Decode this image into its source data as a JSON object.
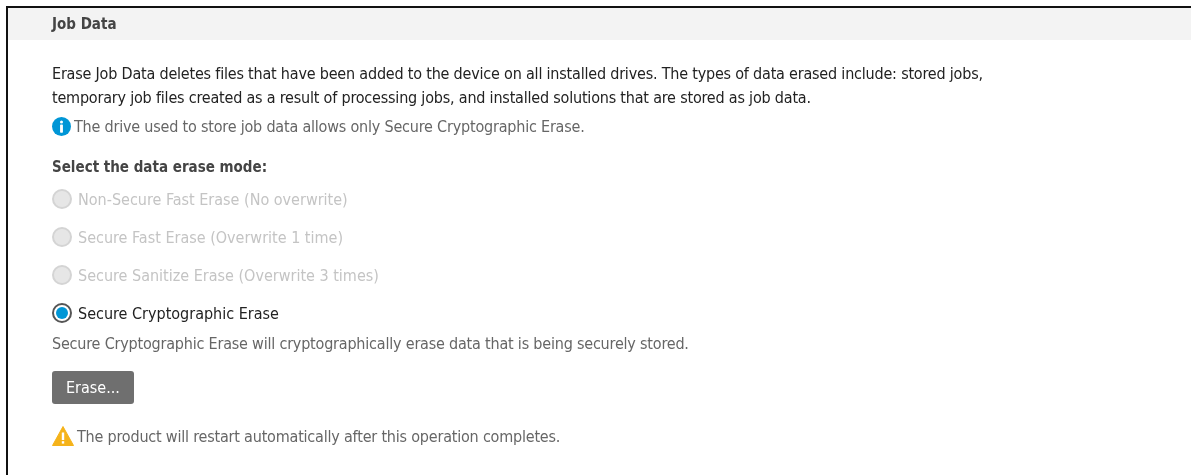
{
  "section": {
    "title": "Job Data"
  },
  "description": "Erase Job Data deletes files that have been added to the device on all installed drives. The types of data erased include: stored jobs, temporary job files created as a result of processing jobs, and installed solutions that are stored as job data.",
  "info_note": "The drive used to store job data allows only Secure Cryptographic Erase.",
  "mode_label": "Select the data erase mode:",
  "modes": [
    {
      "label": "Non-Secure Fast Erase (No overwrite)",
      "selected": false,
      "disabled": true
    },
    {
      "label": "Secure Fast Erase (Overwrite 1 time)",
      "selected": false,
      "disabled": true
    },
    {
      "label": "Secure Sanitize Erase (Overwrite 3 times)",
      "selected": false,
      "disabled": true
    },
    {
      "label": "Secure Cryptographic Erase",
      "selected": true,
      "disabled": false
    }
  ],
  "mode_description": "Secure Cryptographic Erase will cryptographically erase data that is being securely stored.",
  "erase_button": "Erase...",
  "warning_note": "The product will restart automatically after this operation completes."
}
